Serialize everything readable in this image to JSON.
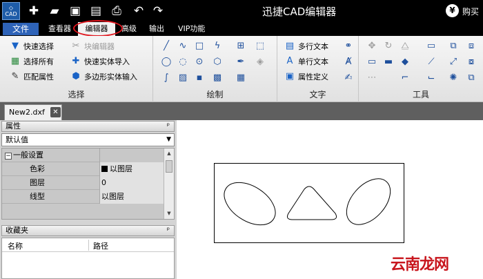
{
  "app": {
    "logo_text": "CAD",
    "title": "迅捷CAD编辑器",
    "buy_label": "购买",
    "buy_icon": "yen-icon"
  },
  "quick_access": [
    "new-icon",
    "open-folder-icon",
    "save-icon",
    "save-as-icon",
    "print-icon",
    "undo-icon",
    "redo-icon"
  ],
  "menu": {
    "file": "文件",
    "items": [
      "查看器",
      "编辑器",
      "高级",
      "输出",
      "VIP功能"
    ],
    "active": "编辑器"
  },
  "ribbon": {
    "select_group": {
      "label": "选择",
      "buttons": [
        "快速选择",
        "选择所有",
        "匹配属性",
        "块编辑器",
        "快速实体导入",
        "多边形实体输入"
      ]
    },
    "draw_group": {
      "label": "绘制"
    },
    "text_group": {
      "label": "文字",
      "buttons": [
        "多行文本",
        "单行文本",
        "属性定义"
      ]
    },
    "tools_group": {
      "label": "工具"
    }
  },
  "document": {
    "tab_label": "New2.dxf"
  },
  "properties_panel": {
    "title": "属性",
    "pin": "ᵖ",
    "selector": "默认值",
    "section": "一般设置",
    "rows": [
      {
        "name": "色彩",
        "value": "以图层"
      },
      {
        "name": "图层",
        "value": "0"
      },
      {
        "name": "线型",
        "value": "以图层"
      }
    ]
  },
  "favorites_panel": {
    "title": "收藏夹",
    "columns": [
      "名称",
      "路径"
    ]
  },
  "watermark": "云南龙网"
}
